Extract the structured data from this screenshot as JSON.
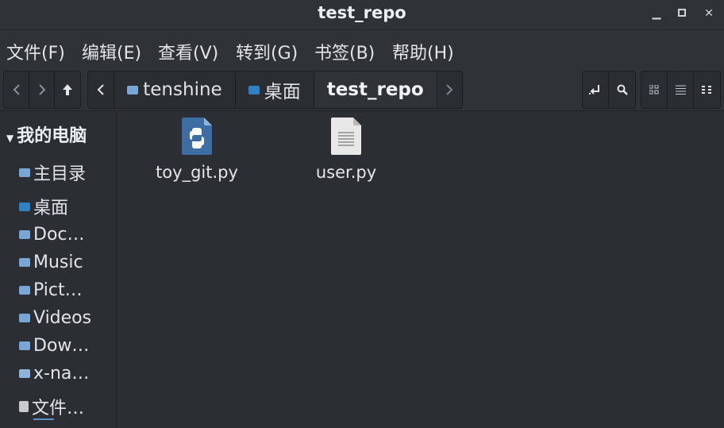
{
  "window": {
    "title": "test_repo"
  },
  "menu": [
    "文件(F)",
    "编辑(E)",
    "查看(V)",
    "转到(G)",
    "书签(B)",
    "帮助(H)"
  ],
  "breadcrumb": [
    "tenshine",
    "桌面",
    "test_repo"
  ],
  "sidebar": {
    "header": "我的电脑",
    "items": [
      {
        "label": "主目录",
        "icon": "home-folder-icon"
      },
      {
        "label": "桌面",
        "icon": "desktop-folder-icon"
      },
      {
        "label": "Doc…",
        "icon": "documents-folder-icon"
      },
      {
        "label": "Music",
        "icon": "music-folder-icon"
      },
      {
        "label": "Pict…",
        "icon": "pictures-folder-icon"
      },
      {
        "label": "Videos",
        "icon": "videos-folder-icon"
      },
      {
        "label": "Dow…",
        "icon": "downloads-folder-icon"
      },
      {
        "label": "x-na…",
        "icon": "network-folder-icon"
      },
      {
        "label": "文件…",
        "icon": "drive-icon"
      }
    ]
  },
  "files": [
    {
      "name": "toy_git.py",
      "icon": "python-file-icon"
    },
    {
      "name": "user.py",
      "icon": "text-file-icon"
    }
  ],
  "colors": {
    "background": "#2b2e33",
    "accent": "#5d8fc4",
    "python": "#3d6da3"
  }
}
